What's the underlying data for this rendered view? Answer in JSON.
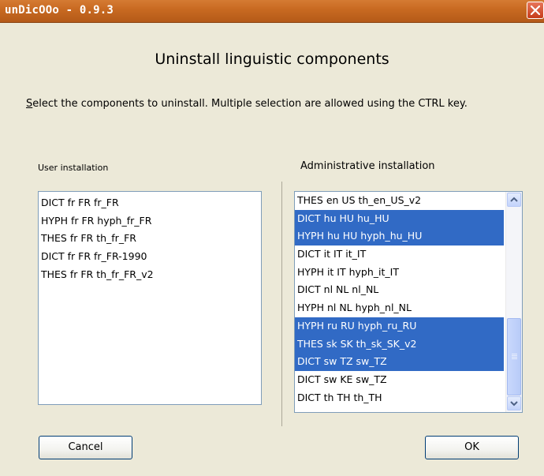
{
  "window": {
    "title": "unDicOOo - 0.9.3"
  },
  "heading": "Uninstall linguistic components",
  "instructions": {
    "mnemonic": "S",
    "text": "elect the components to uninstall. Multiple selection are allowed using the CTRL key."
  },
  "user_list": {
    "label": "User installation",
    "items": [
      "DICT fr FR fr_FR",
      "HYPH fr FR hyph_fr_FR",
      "THES fr FR th_fr_FR",
      "DICT fr FR fr_FR-1990",
      "THES fr FR th_fr_FR_v2"
    ]
  },
  "admin_list": {
    "label": "Administrative installation",
    "items": [
      {
        "text": "THES en US th_en_US_v2",
        "selected": false
      },
      {
        "text": "DICT hu HU hu_HU",
        "selected": true
      },
      {
        "text": "HYPH hu HU hyph_hu_HU",
        "selected": true
      },
      {
        "text": "DICT it IT it_IT",
        "selected": false
      },
      {
        "text": "HYPH it IT hyph_it_IT",
        "selected": false
      },
      {
        "text": "DICT nl NL nl_NL",
        "selected": false
      },
      {
        "text": "HYPH nl NL hyph_nl_NL",
        "selected": false
      },
      {
        "text": "HYPH ru RU hyph_ru_RU",
        "selected": true
      },
      {
        "text": "THES sk SK th_sk_SK_v2",
        "selected": true
      },
      {
        "text": "DICT sw TZ sw_TZ",
        "selected": true
      },
      {
        "text": "DICT sw KE sw_TZ",
        "selected": false
      },
      {
        "text": "DICT th TH th_TH",
        "selected": false
      }
    ]
  },
  "buttons": {
    "cancel": "Cancel",
    "ok": "OK"
  },
  "colors": {
    "title_bar": "#c96a22",
    "selection": "#316ac5",
    "dialog_bg": "#ece9d8",
    "close_button": "#c63d1b"
  },
  "icons": {
    "close": "close-icon",
    "scroll_up": "chevron-up-icon",
    "scroll_down": "chevron-down-icon"
  }
}
